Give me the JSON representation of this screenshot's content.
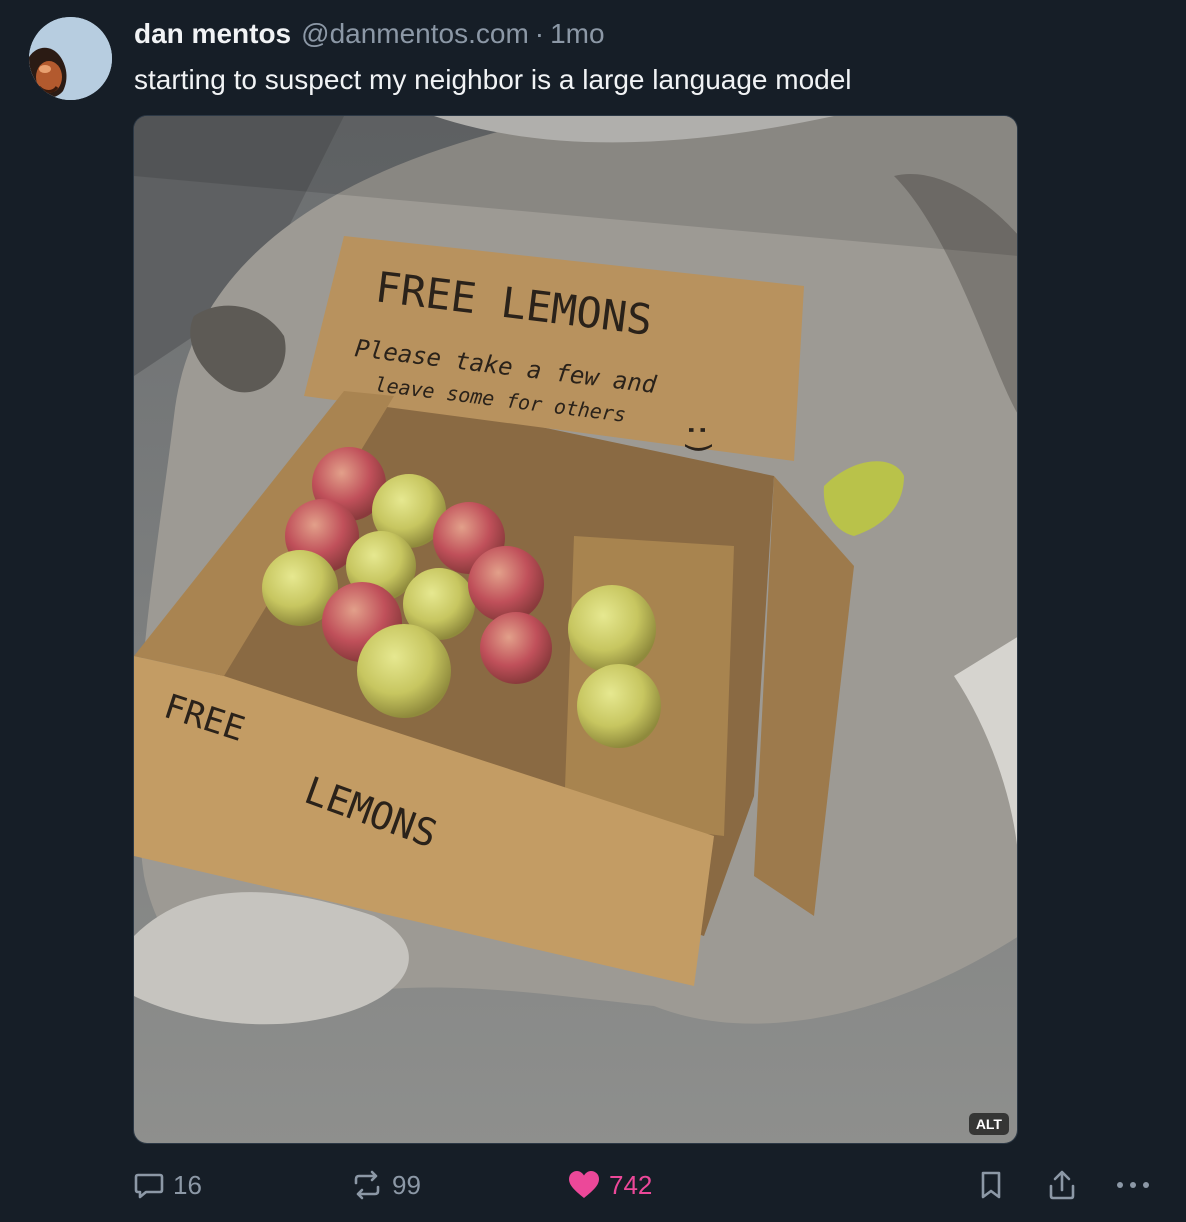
{
  "post": {
    "author": {
      "display_name": "dan mentos",
      "handle": "@danmentos.com",
      "separator": "·",
      "time": "1mo"
    },
    "text": "starting to suspect my neighbor is a large language model",
    "image": {
      "alt_badge": "ALT",
      "sign_lines": [
        "FREE LEMONS",
        "Please take a few and",
        "leave some for others",
        ":)"
      ],
      "box_side_lines": [
        "FREE",
        "LEMONS"
      ]
    },
    "stats": {
      "replies": "16",
      "reposts": "99",
      "likes": "742"
    }
  },
  "icons": {
    "reply": "speech-bubble-icon",
    "repost": "repost-arrows-icon",
    "like": "heart-icon",
    "bookmark": "bookmark-icon",
    "share": "share-icon",
    "more": "more-dots-icon"
  },
  "colors": {
    "background": "#161e27",
    "text": "#f1f3f5",
    "muted": "#8c98a6",
    "like": "#ec4899"
  }
}
